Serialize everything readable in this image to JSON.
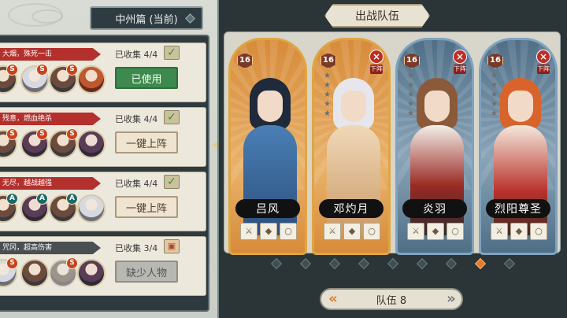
{
  "chapter": {
    "title": "中州篇 (当前)"
  },
  "entries": [
    {
      "banner": "大烟，殊死一击",
      "collected": "已收集 4/4",
      "action": "已使用",
      "state": "used"
    },
    {
      "banner": "残意，燃血绝杀",
      "collected": "已收集 4/4",
      "action": "一键上阵",
      "state": "deploy"
    },
    {
      "banner": "无尽，越战越强",
      "collected": "已收集 4/4",
      "action": "一键上阵",
      "state": "deploy"
    },
    {
      "banner": "咒冈，超高伤害",
      "collected": "已收集 3/4",
      "action": "缺少人物",
      "state": "missing"
    }
  ],
  "panel": {
    "title": "出战队伍"
  },
  "cards": [
    {
      "name": "吕风",
      "level": "16",
      "frame": "gold",
      "stars": 0,
      "removable": false
    },
    {
      "name": "邓灼月",
      "level": "16",
      "frame": "gold",
      "stars": 5,
      "removable": true,
      "remove_label": "下阵"
    },
    {
      "name": "炎羽",
      "level": "16",
      "frame": "blue",
      "stars": 5,
      "removable": true,
      "remove_label": "下阵"
    },
    {
      "name": "烈阳尊圣",
      "level": "16",
      "frame": "blue",
      "stars": 5,
      "removable": true,
      "remove_label": "下阵"
    }
  ],
  "pager": {
    "total": 9,
    "active": 8
  },
  "team": {
    "label": "队伍 8"
  },
  "colors": {
    "accent": "#e27a2a",
    "used_green": "#3d8a4e",
    "banner_red": "#b4302c"
  }
}
